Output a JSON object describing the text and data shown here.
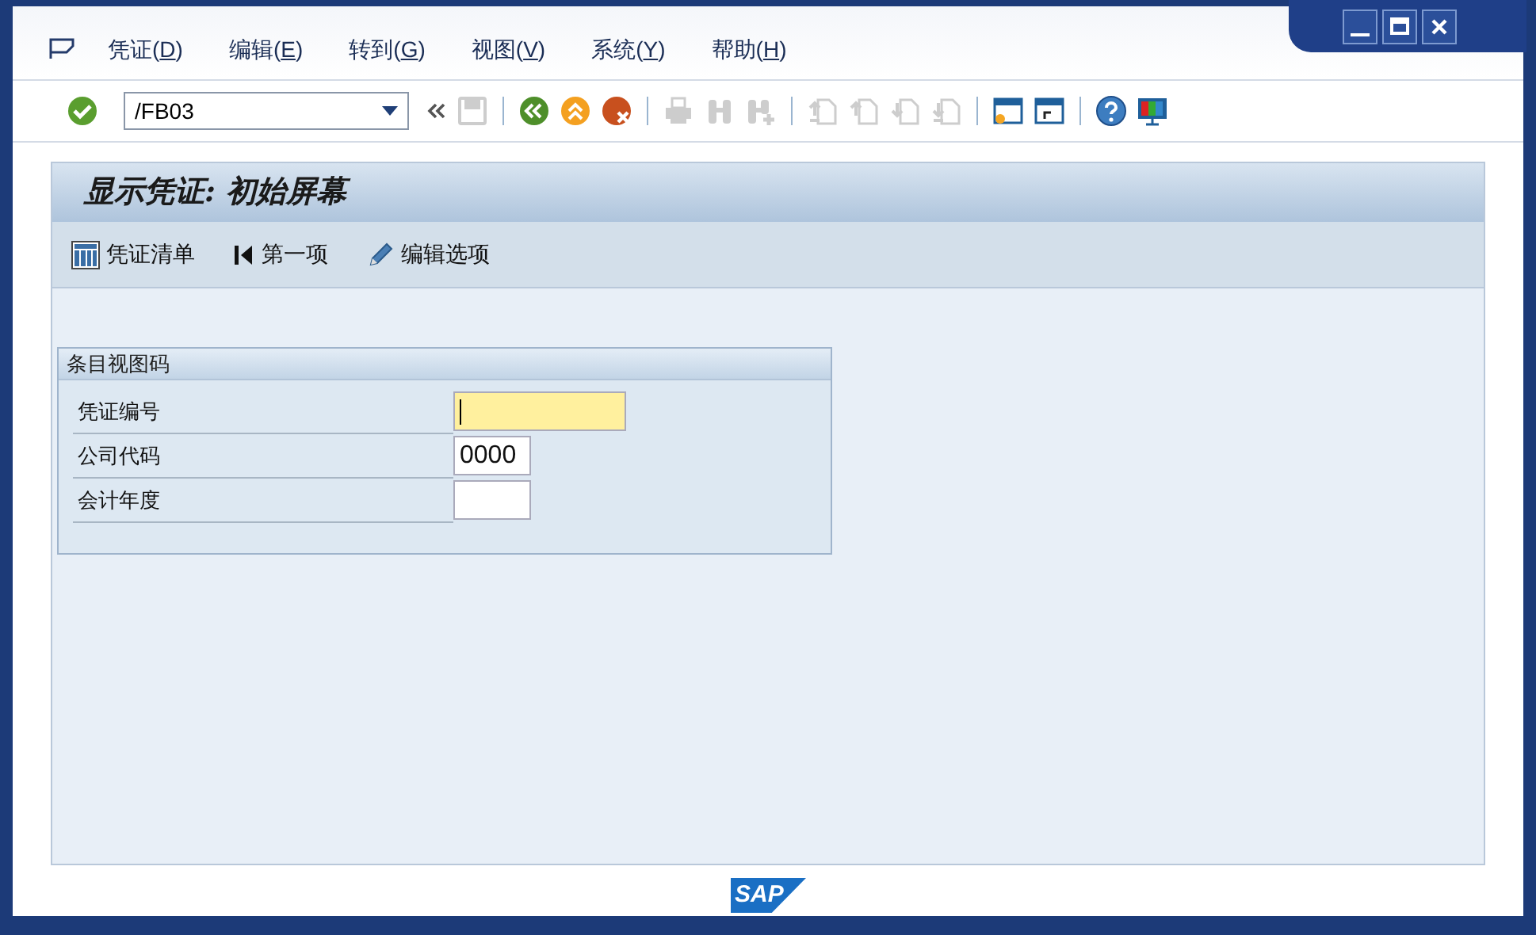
{
  "menu": [
    {
      "label": "凭证(",
      "key": "D",
      "tail": ")"
    },
    {
      "label": "编辑(",
      "key": "E",
      "tail": ")"
    },
    {
      "label": "转到(",
      "key": "G",
      "tail": ")"
    },
    {
      "label": "视图(",
      "key": "V",
      "tail": ")"
    },
    {
      "label": "系统(",
      "key": "Y",
      "tail": ")"
    },
    {
      "label": "帮助(",
      "key": "H",
      "tail": ")"
    }
  ],
  "command_field": {
    "value": "/FB03"
  },
  "toolbar": [
    {
      "kind": "enter",
      "disabled": false
    },
    {
      "kind": "collapse",
      "disabled": false
    },
    {
      "kind": "save",
      "disabled": true
    },
    {
      "kind": "sep"
    },
    {
      "kind": "back",
      "disabled": false
    },
    {
      "kind": "exit",
      "disabled": false
    },
    {
      "kind": "cancel",
      "disabled": false
    },
    {
      "kind": "sep"
    },
    {
      "kind": "print",
      "disabled": true
    },
    {
      "kind": "find",
      "disabled": true
    },
    {
      "kind": "findnext",
      "disabled": true
    },
    {
      "kind": "sep"
    },
    {
      "kind": "first",
      "disabled": true
    },
    {
      "kind": "prev",
      "disabled": true
    },
    {
      "kind": "next",
      "disabled": true
    },
    {
      "kind": "last",
      "disabled": true
    },
    {
      "kind": "sep"
    },
    {
      "kind": "newsession",
      "disabled": false
    },
    {
      "kind": "shortcut",
      "disabled": false
    },
    {
      "kind": "sep"
    },
    {
      "kind": "help",
      "disabled": false
    },
    {
      "kind": "layout",
      "disabled": false
    }
  ],
  "screen_title": "显示凭证: 初始屏幕",
  "app_toolbar": [
    {
      "kind": "list",
      "label": "凭证清单"
    },
    {
      "kind": "first",
      "label": "第一项"
    },
    {
      "kind": "edit",
      "label": "编辑选项"
    }
  ],
  "group": {
    "title": "条目视图码",
    "fields": [
      {
        "label": "凭证编号",
        "focused": true,
        "kind": "wide"
      },
      {
        "label": "公司代码",
        "value": "0000",
        "focused": false,
        "kind": "narrow"
      },
      {
        "label": "会计年度",
        "focused": false,
        "kind": "narrow"
      }
    ]
  },
  "logo": "SAP"
}
